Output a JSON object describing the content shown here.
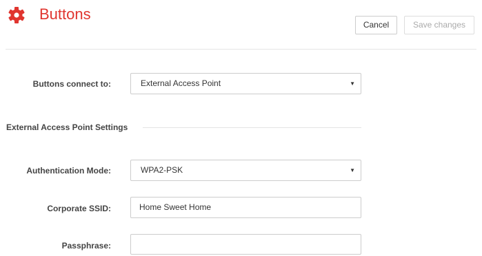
{
  "header": {
    "title": "Buttons",
    "accent_color": "#e0352f",
    "icon": "gear-icon",
    "cancel_label": "Cancel",
    "save_label": "Save changes"
  },
  "form": {
    "connect_label": "Buttons connect to:",
    "connect_value": "External Access Point",
    "section_heading": "External Access Point Settings",
    "auth_label": "Authentication Mode:",
    "auth_value": "WPA2-PSK",
    "ssid_label": "Corporate SSID:",
    "ssid_value": "Home Sweet Home",
    "passphrase_label": "Passphrase:",
    "passphrase_value": ""
  }
}
